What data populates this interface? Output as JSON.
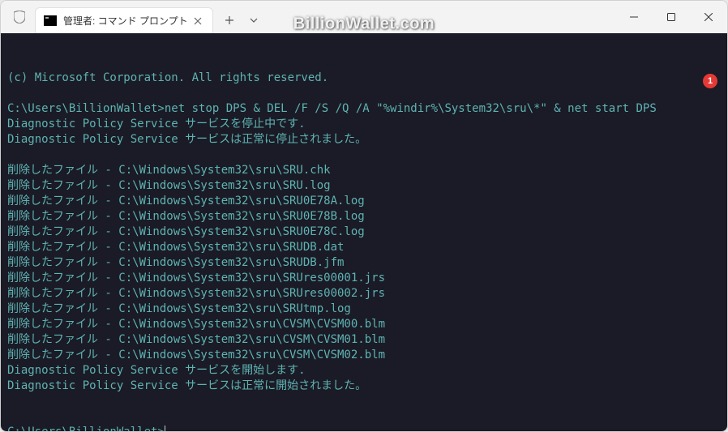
{
  "window": {
    "tab_title": "管理者: コマンド プロンプト",
    "watermark": "BillionWallet.com"
  },
  "badge": "1",
  "terminal": {
    "copyright": "(c) Microsoft Corporation. All rights reserved.",
    "prompt_path": "C:\\Users\\BillionWallet>",
    "command": "net stop DPS & DEL /F /S /Q /A \"%windir%\\System32\\sru\\*\" & net start DPS",
    "stop_msg1": "Diagnostic Policy Service サービスを停止中です.",
    "stop_msg2": "Diagnostic Policy Service サービスは正常に停止されました。",
    "deleted_prefix": "削除したファイル - ",
    "files": [
      "C:\\Windows\\System32\\sru\\SRU.chk",
      "C:\\Windows\\System32\\sru\\SRU.log",
      "C:\\Windows\\System32\\sru\\SRU0E78A.log",
      "C:\\Windows\\System32\\sru\\SRU0E78B.log",
      "C:\\Windows\\System32\\sru\\SRU0E78C.log",
      "C:\\Windows\\System32\\sru\\SRUDB.dat",
      "C:\\Windows\\System32\\sru\\SRUDB.jfm",
      "C:\\Windows\\System32\\sru\\SRUres00001.jrs",
      "C:\\Windows\\System32\\sru\\SRUres00002.jrs",
      "C:\\Windows\\System32\\sru\\SRUtmp.log",
      "C:\\Windows\\System32\\sru\\CVSM\\CVSM00.blm",
      "C:\\Windows\\System32\\sru\\CVSM\\CVSM01.blm",
      "C:\\Windows\\System32\\sru\\CVSM\\CVSM02.blm"
    ],
    "start_msg1": "Diagnostic Policy Service サービスを開始します.",
    "start_msg2": "Diagnostic Policy Service サービスは正常に開始されました。"
  }
}
